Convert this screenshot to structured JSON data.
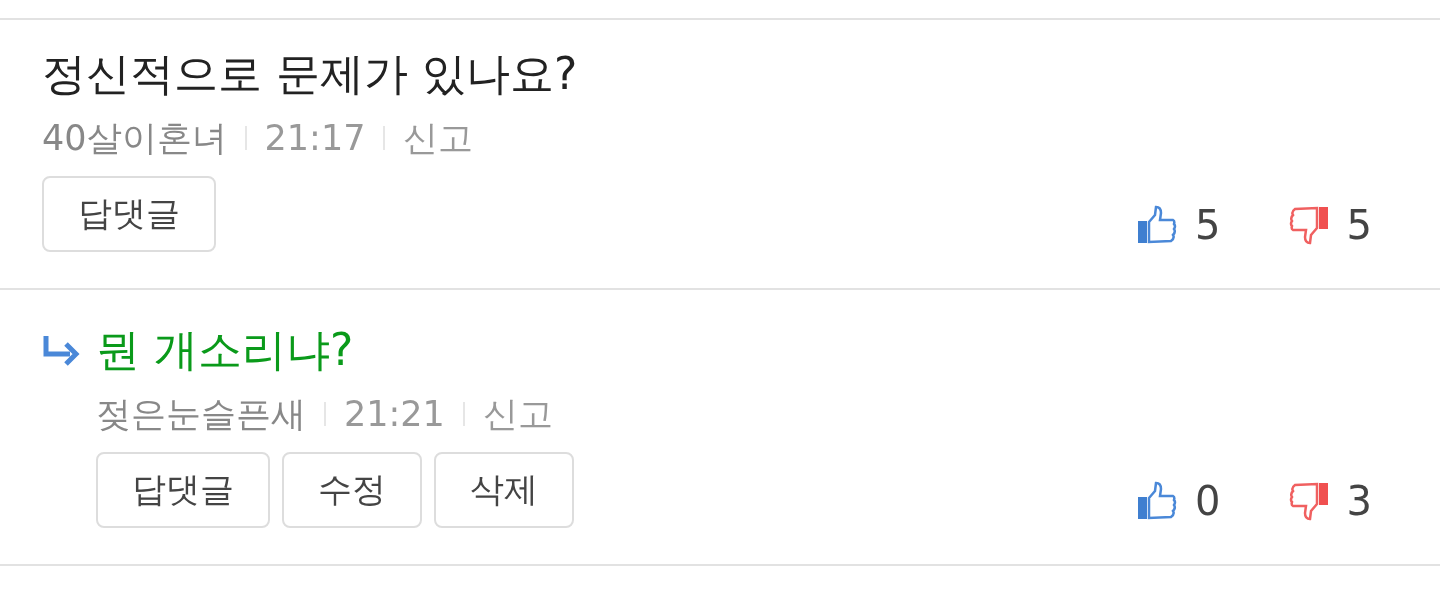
{
  "comments": [
    {
      "kind": "comment",
      "text": "정신적으로 문제가 있나요?",
      "author": "40살이혼녀",
      "time": "21:17",
      "report": "신고",
      "buttons": [
        "답댓글"
      ],
      "likes": "5",
      "dislikes": "5"
    },
    {
      "kind": "reply",
      "text": "뭔 개소리냐?",
      "author": "젖은눈슬픈새",
      "time": "21:21",
      "report": "신고",
      "buttons": [
        "답댓글",
        "수정",
        "삭제"
      ],
      "likes": "0",
      "dislikes": "3"
    }
  ]
}
